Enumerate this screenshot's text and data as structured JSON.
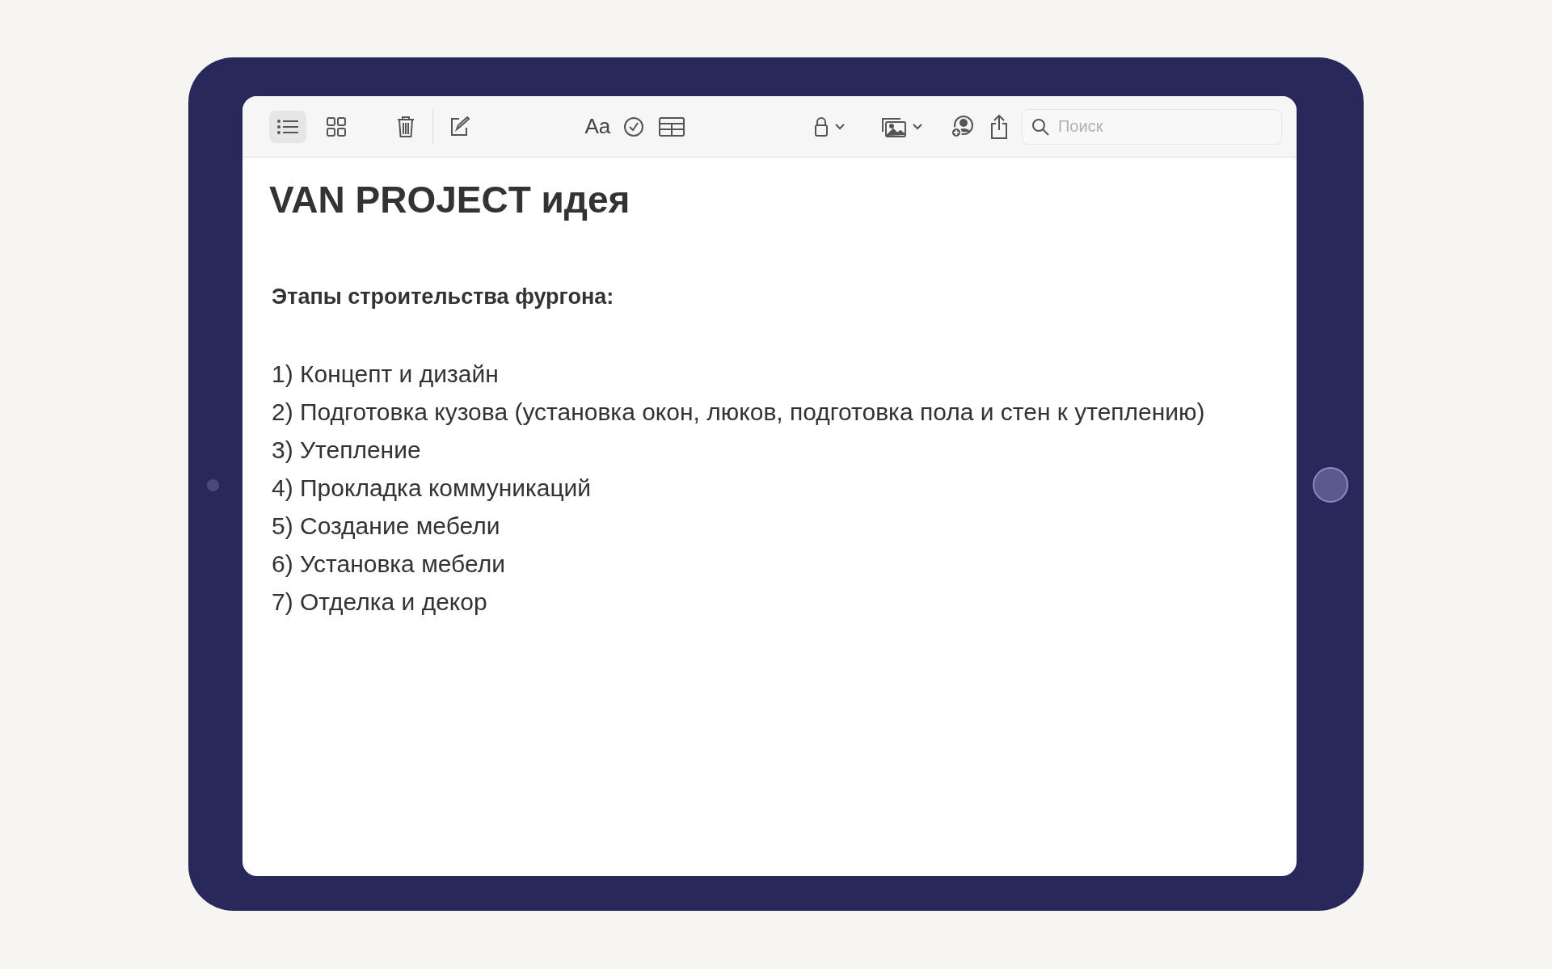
{
  "toolbar": {
    "view_buttons": [
      {
        "kind": "list",
        "selected": true
      },
      {
        "kind": "grid",
        "selected": false
      }
    ],
    "format_label": "Aa",
    "search": {
      "placeholder": "Поиск"
    }
  },
  "note": {
    "title": "VAN PROJECT идея",
    "heading": "Этапы строительства фургона:",
    "lines": [
      "1) Концепт и дизайн",
      "2) Подготовка кузова (установка окон, люков, подготовка пола и стен к утеплению)",
      "3) Утепление",
      "4) Прокладка коммуникаций",
      "5) Создание мебели",
      "6) Установка мебели",
      "7) Отделка и декор"
    ]
  }
}
